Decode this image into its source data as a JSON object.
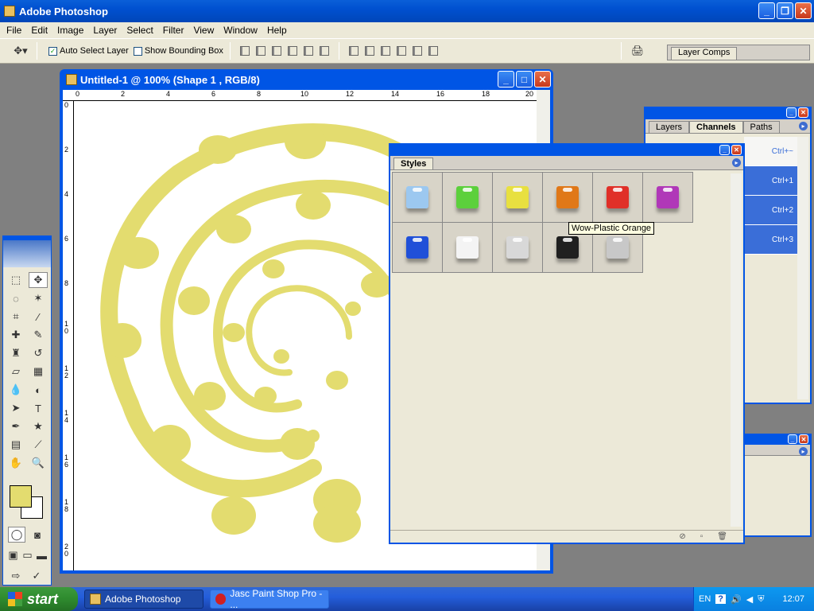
{
  "app": {
    "title": "Adobe Photoshop"
  },
  "menu": [
    "File",
    "Edit",
    "Image",
    "Layer",
    "Select",
    "Filter",
    "View",
    "Window",
    "Help"
  ],
  "options": {
    "auto_select": "Auto Select Layer",
    "bounding_box": "Show Bounding Box"
  },
  "layer_comps": {
    "tab": "Layer Comps"
  },
  "document": {
    "title": "Untitled-1 @ 100% (Shape 1 , RGB/8)",
    "ruler_h": [
      "0",
      "2",
      "4",
      "6",
      "8",
      "10",
      "12",
      "14",
      "16",
      "18",
      "20"
    ],
    "ruler_v": [
      "0",
      "2",
      "4",
      "6",
      "8",
      "1\n0",
      "1\n2",
      "1\n4",
      "1\n6",
      "1\n8",
      "2\n0"
    ]
  },
  "styles_panel": {
    "tab": "Styles",
    "tooltip": "Wow-Plastic Orange",
    "swatches": [
      "#9cc8f0",
      "#5cd03c",
      "#e8e040",
      "#e07818",
      "#e03028",
      "#b038b8",
      "#2050d8",
      "#f4f4f4",
      "#d8d8d8",
      "#202020",
      "#c8c8c8"
    ]
  },
  "layers_panel": {
    "tabs": [
      "Layers",
      "Channels",
      "Paths"
    ],
    "shortcuts": [
      "Ctrl+~",
      "Ctrl+1",
      "Ctrl+2",
      "Ctrl+3"
    ]
  },
  "taskbar": {
    "start": "start",
    "tasks": [
      "Adobe Photoshop",
      "Jasc Paint Shop Pro - ..."
    ],
    "lang": "EN",
    "clock": "12:07"
  },
  "colors": {
    "foreground": "#e3dc6f",
    "background": "#ffffff",
    "shape": "#e3dc6f"
  }
}
